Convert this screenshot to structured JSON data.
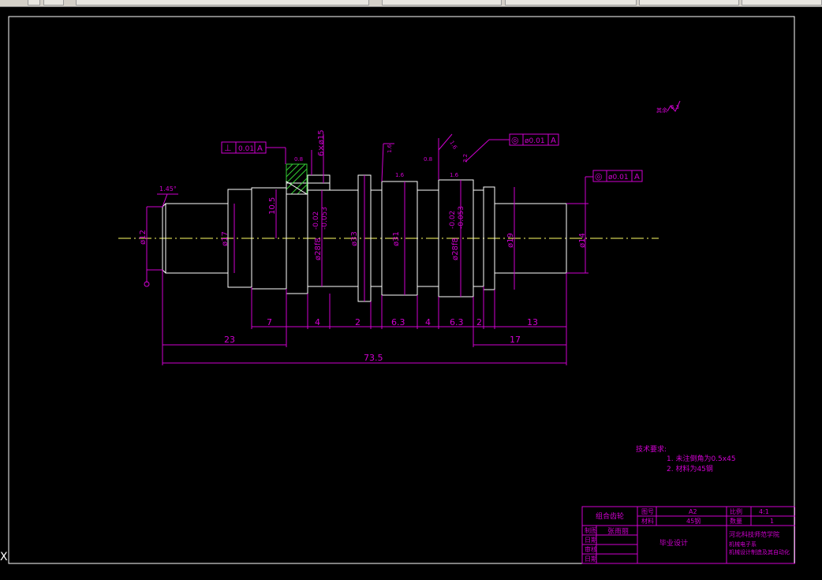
{
  "colors": {
    "dimension": "#d000d0",
    "outline": "#ffffff",
    "centerline": "#ffff66",
    "hatch": "#33cc33",
    "background": "#000000",
    "toolbar": "#d4d0c8"
  },
  "toolbar": {
    "icons": [
      "layers-icon",
      "grid-icon",
      "dropdown-icon",
      "properties-icon"
    ]
  },
  "drawing": {
    "roughness_note": "其余",
    "roughness_value": "6.3",
    "chamfer_label": "1.45°",
    "dims": {
      "d12": "ø12",
      "d17": "ø17",
      "d28f8_left": "ø28f8",
      "tol_left_upper": "-0.02",
      "tol_left_lower": "-0.053",
      "d33": "ø33",
      "d31": "ø31",
      "d28f8_right": "ø28f8",
      "tol_right_upper": "-0.02",
      "tol_right_lower": "-0.053",
      "d19": "ø19",
      "d14": "ø14",
      "keyway_depth": "10.5",
      "keyway": "6×ø15",
      "len_7": "7",
      "len_4a": "4",
      "len_2a": "2",
      "len_63a": "6.3",
      "len_4b": "4",
      "len_63b": "6.3",
      "len_2b": "2",
      "len_13": "13",
      "len_23": "23",
      "len_17": "17",
      "len_total": "73.5",
      "rough_16a": "1.6",
      "rough_16b": "1.6",
      "rough_08a": "0.8",
      "rough_08b": "0.8",
      "rough_16c": "1.6",
      "rough_16d": "1.6",
      "rough_32": "3.2"
    },
    "tolerance_frames": [
      {
        "symbol": "⊥",
        "value": "0.01",
        "datum": "A"
      },
      {
        "symbol": "◎",
        "value": "ø0.01",
        "datum": "A"
      },
      {
        "symbol": "◎",
        "value": "ø0.01",
        "datum": "A"
      }
    ]
  },
  "notes": {
    "title": "技术要求:",
    "line1": "1. 未注倒角为0.5x45",
    "line2": "2. 材料为45钢"
  },
  "title_block": {
    "part_name": "组合齿轮",
    "label_drawing_no": "图号",
    "value_drawing_no": "A2",
    "label_material": "材料",
    "value_material": "45钢",
    "label_scale": "比例",
    "value_scale": "4:1",
    "label_qty": "数量",
    "value_qty": "1",
    "label_designer": "制图",
    "value_designer": "张雨丽",
    "label_check": "审核",
    "label_date1": "日期",
    "label_date2": "日期",
    "project": "毕业设计",
    "school_line1": "河北科技师范学院",
    "school_line2": "机械电子系",
    "school_line3": "机械设计制造及其自动化"
  },
  "ucs_label": "X"
}
